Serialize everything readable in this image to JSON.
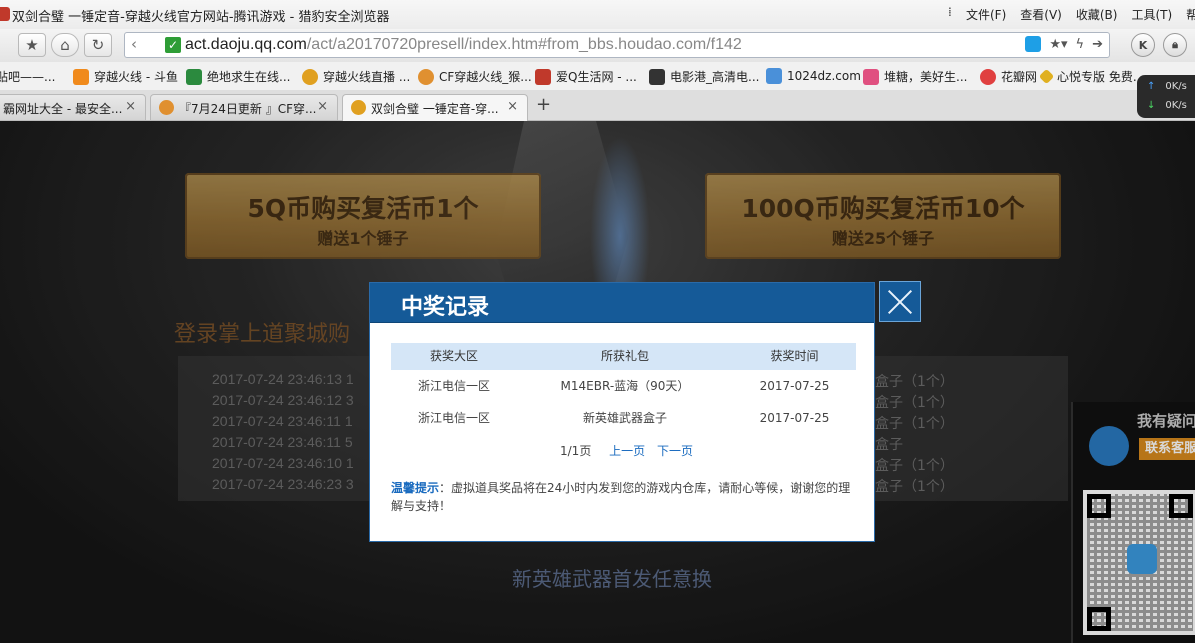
{
  "window": {
    "title": "双剑合璧 一锤定音-穿越火线官方网站-腾讯游戏 - 猎豹安全浏览器",
    "menu": [
      "文件(F)",
      "查看(V)",
      "收藏(B)",
      "工具(T)",
      "帮助"
    ]
  },
  "address": {
    "host": "act.daoju.qq.com",
    "path": "/act/a20170720presell/index.htm#from_bbs.houdao.com/f142"
  },
  "nav_buttons": {
    "star": "★",
    "home": "⌂",
    "reload": "↻",
    "back": "‹",
    "k": "K"
  },
  "bookmarks": [
    {
      "label": "贴吧——...",
      "color": "#d04030"
    },
    {
      "label": "穿越火线 - 斗鱼",
      "color": "#f08a1c"
    },
    {
      "label": "绝地求生在线...",
      "color": "#2b8a3e"
    },
    {
      "label": "穿越火线直播 ...",
      "color": "#e0a020"
    },
    {
      "label": "CF穿越火线_猴...",
      "color": "#e09030"
    },
    {
      "label": "爱Q生活网 - ...",
      "color": "#c0392b"
    },
    {
      "label": "电影港_高清电...",
      "color": "#333333"
    },
    {
      "label": "1024dz.com",
      "color": "#4a90d9"
    },
    {
      "label": "堆糖，美好生...",
      "color": "#e05080"
    },
    {
      "label": "花瓣网",
      "color": "#e04040"
    },
    {
      "label": "心悦专版 免费...",
      "color": "#e0b020"
    }
  ],
  "tabs": [
    {
      "label": "霸网址大全 - 最安全...",
      "active": false,
      "color": "#3a7bd5"
    },
    {
      "label": "『7月24日更新 』CF穿...",
      "active": false,
      "color": "#e09030"
    },
    {
      "label": "双剑合璧 一锤定音-穿...",
      "active": true,
      "color": "#e0a020"
    }
  ],
  "tab_close": "×",
  "new_tab": "+",
  "speed": {
    "up": "0K/s",
    "down": "0K/s"
  },
  "page": {
    "offer1": {
      "main": "5Q币购买复活币1个",
      "sub": "赠送1个锤子"
    },
    "offer2": {
      "main": "100Q币购买复活币10个",
      "sub": "赠送25个锤子"
    },
    "promo": "登录掌上道聚城购",
    "records": [
      {
        "time": "2017-07-24 23:46:13",
        "mid": "1",
        "tail": "盒子（1个）"
      },
      {
        "time": "2017-07-24 23:46:12",
        "mid": "3",
        "tail": "盒子（1个）"
      },
      {
        "time": "2017-07-24 23:46:11",
        "mid": "1",
        "tail": "盒子（1个）"
      },
      {
        "time": "2017-07-24 23:46:11",
        "mid": "5",
        "tail": "盒子"
      },
      {
        "time": "2017-07-24 23:46:10",
        "mid": "1",
        "tail": "盒子（1个）"
      },
      {
        "time": "2017-07-24 23:46:23",
        "mid": "3",
        "tail": "盒子（1个）"
      }
    ],
    "new_hero": "新英雄武器首发任意换",
    "service": {
      "question": "我有疑问",
      "contact": "联系客服"
    }
  },
  "modal": {
    "title": "中奖记录",
    "headers": [
      "获奖大区",
      "所获礼包",
      "获奖时间"
    ],
    "rows": [
      [
        "浙江电信一区",
        "M14EBR-蓝海（90天）",
        "2017-07-25"
      ],
      [
        "浙江电信一区",
        "新英雄武器盒子",
        "2017-07-25"
      ]
    ],
    "pager": {
      "page": "1/1页",
      "prev": "上一页",
      "next": "下一页"
    },
    "tip_label": "温馨提示",
    "tip_text": "：虚拟道具奖品将在24小时内发到您的游戏内仓库，请耐心等候，谢谢您的理解与支持！"
  }
}
